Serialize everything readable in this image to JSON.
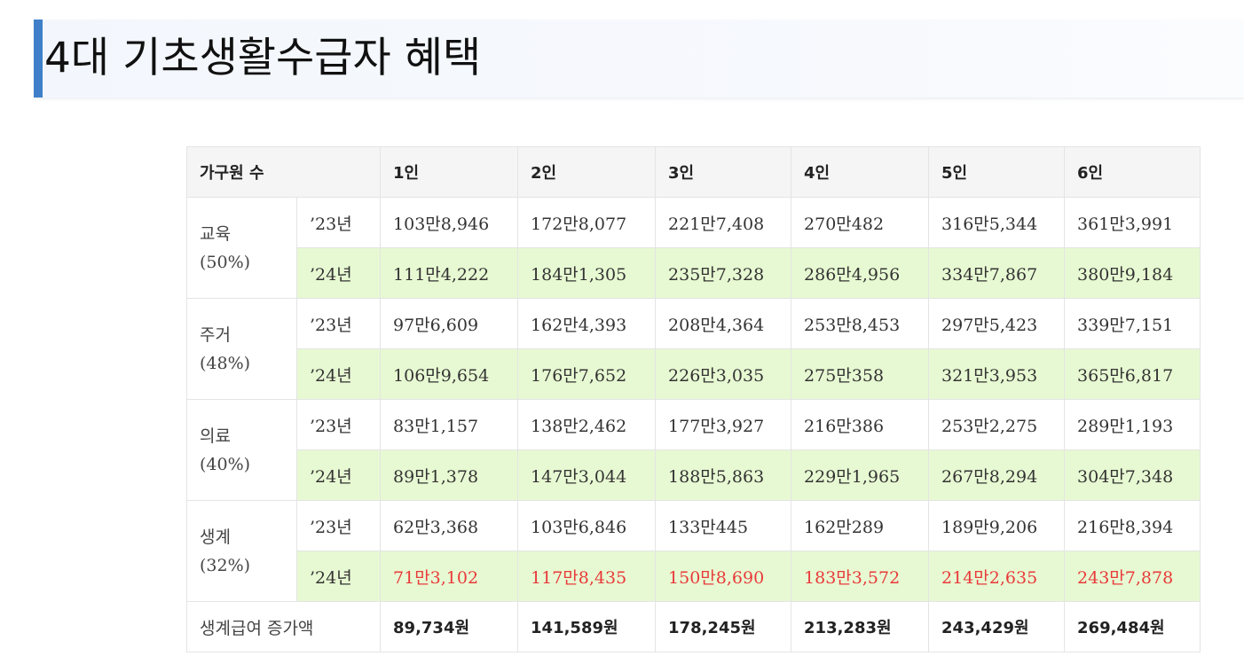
{
  "heading": {
    "title": "4대 기초생활수급자 혜택"
  },
  "table": {
    "header_label": "가구원 수",
    "columns": [
      "1인",
      "2인",
      "3인",
      "4인",
      "5인",
      "6인"
    ],
    "categories": [
      {
        "name": "교육",
        "pct": "(50%)",
        "rows": [
          {
            "year": "’23년",
            "values": [
              "103만8,946",
              "172만8,077",
              "221만7,408",
              "270만482",
              "316만5,344",
              "361만3,991"
            ]
          },
          {
            "year": "’24년",
            "values": [
              "111만4,222",
              "184만1,305",
              "235만7,328",
              "286만4,956",
              "334만7,867",
              "380만9,184"
            ]
          }
        ]
      },
      {
        "name": "주거",
        "pct": "(48%)",
        "rows": [
          {
            "year": "’23년",
            "values": [
              "97만6,609",
              "162만4,393",
              "208만4,364",
              "253만8,453",
              "297만5,423",
              "339만7,151"
            ]
          },
          {
            "year": "’24년",
            "values": [
              "106만9,654",
              "176만7,652",
              "226만3,035",
              "275만358",
              "321만3,953",
              "365만6,817"
            ]
          }
        ]
      },
      {
        "name": "의료",
        "pct": "(40%)",
        "rows": [
          {
            "year": "’23년",
            "values": [
              "83만1,157",
              "138만2,462",
              "177만3,927",
              "216만386",
              "253만2,275",
              "289만1,193"
            ]
          },
          {
            "year": "’24년",
            "values": [
              "89만1,378",
              "147만3,044",
              "188만5,863",
              "229만1,965",
              "267만8,294",
              "304만7,348"
            ]
          }
        ]
      },
      {
        "name": "생계",
        "pct": "(32%)",
        "rows": [
          {
            "year": "’23년",
            "values": [
              "62만3,368",
              "103만6,846",
              "133만445",
              "162만289",
              "189만9,206",
              "216만8,394"
            ]
          },
          {
            "year": "’24년",
            "values": [
              "71만3,102",
              "117만8,435",
              "150만8,690",
              "183만3,572",
              "214만2,635",
              "243만7,878"
            ]
          }
        ]
      }
    ],
    "total": {
      "label": "생계급여 증가액",
      "values": [
        "89,734원",
        "141,589원",
        "178,245원",
        "213,283원",
        "243,429원",
        "269,484원"
      ]
    }
  },
  "colors": {
    "accent": "#3f7fc9",
    "highlight_row": "#e7f9d2",
    "emphasis_text": "#e83a3a",
    "header_bg": "#f5f5f5"
  }
}
